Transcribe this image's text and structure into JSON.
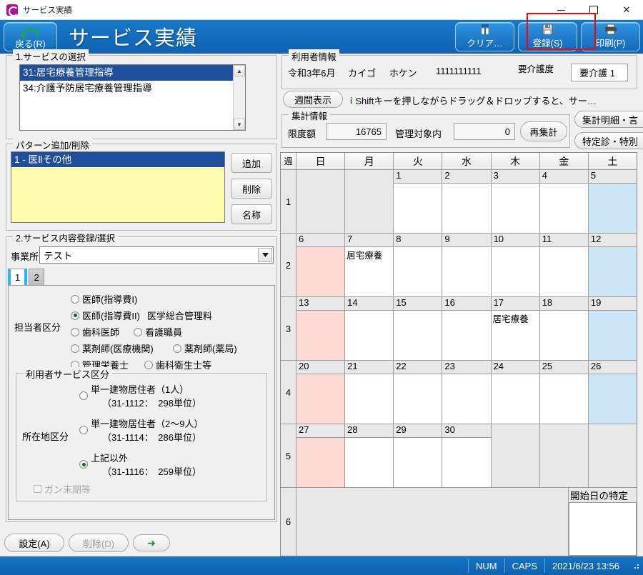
{
  "window": {
    "title": "サービス実績",
    "icon": "app-icon",
    "minimize": "–",
    "maximize": "▫",
    "close": "✕"
  },
  "header": {
    "back_label": "戻る(R)",
    "back_key": "R",
    "page_title": "サービス実績",
    "buttons": [
      {
        "name": "clear",
        "label": "クリア…",
        "icon": "eraser-icon"
      },
      {
        "name": "register",
        "label": "登録(S)",
        "icon": "floppy-disk-icon",
        "highlighted": true
      },
      {
        "name": "print",
        "label": "印刷(P)",
        "icon": "printer-icon"
      }
    ],
    "highlight_color": "#ff0000"
  },
  "service_select": {
    "legend": "1.サービスの選択",
    "items": [
      {
        "label": "31:居宅療養管理指導",
        "selected": true
      },
      {
        "label": "34:介護予防居宅療養管理指導",
        "selected": false
      }
    ]
  },
  "pattern": {
    "legend": "パターン追加/削除",
    "items": [
      {
        "label": "1 - 医Ⅱその他",
        "selected": true
      }
    ],
    "buttons": [
      {
        "name": "add",
        "label": "追加"
      },
      {
        "name": "delete",
        "label": "削除"
      },
      {
        "name": "rename",
        "label": "名称"
      }
    ]
  },
  "service_content": {
    "legend": "2.サービス内容登録/選択",
    "office_label": "事業所",
    "office_value": "テスト",
    "tabs": [
      {
        "label": "1",
        "active": true
      },
      {
        "label": "2",
        "active": false
      }
    ],
    "staff_label": "担当者区分",
    "staff_options": [
      {
        "label": "医師(指導費I)",
        "selected": false
      },
      {
        "label": "医師(指導費II)",
        "selected": true,
        "extra": "医学総合管理料"
      },
      {
        "label": "歯科医師",
        "selected": false
      },
      {
        "label": "看護職員",
        "selected": false
      },
      {
        "label": "薬剤師(医療機関)",
        "selected": false
      },
      {
        "label": "薬剤師(薬局)",
        "selected": false
      },
      {
        "label": "管理栄養士",
        "selected": false
      },
      {
        "label": "歯科衛生士等",
        "selected": false
      }
    ],
    "user_service_legend": "利用者サービス区分",
    "location_label": "所在地区分",
    "location_options": [
      {
        "line1": "単一建物居住者（1人）",
        "line2": "（31-1112：　298単位）",
        "selected": false
      },
      {
        "line1": "単一建物居住者（2〜9人）",
        "line2": "（31-1114：　286単位）",
        "selected": false
      },
      {
        "line1": "上記以外",
        "line2": "（31-1116：　259単位）",
        "selected": true
      }
    ],
    "cancer_checkbox": {
      "label": "ガン末期等",
      "checked": false,
      "disabled": true
    }
  },
  "user_info": {
    "legend": "利用者情報",
    "period": "令和3年6月",
    "name_kana1": "カイゴ",
    "name_kana2": "ホケン",
    "insured_no": "1111111111",
    "care_level_label": "要介護度",
    "care_level_value": "要介護 1"
  },
  "toolbar2": {
    "weekly_view": "週間表示",
    "info_icon": "info-icon",
    "hint": "Shiftキーを押しながらドラッグ＆ドロップすると、サー…"
  },
  "aggregate": {
    "legend": "集計情報",
    "limit_label": "限度額",
    "limit_value": "16765",
    "managed_label": "管理対象内",
    "managed_value": "0",
    "recalc_label": "再集計",
    "side_buttons": [
      {
        "name": "detail",
        "label": "集計明細・言"
      },
      {
        "name": "special",
        "label": "特定診・特別"
      }
    ]
  },
  "calendar": {
    "week_header": "週",
    "weekday_headers": [
      "日",
      "月",
      "火",
      "水",
      "木",
      "金",
      "土"
    ],
    "rows": [
      {
        "week": "1",
        "days": [
          {
            "num": "",
            "empty": true
          },
          {
            "num": "",
            "empty": true
          },
          {
            "num": "1",
            "entry": ""
          },
          {
            "num": "2",
            "entry": ""
          },
          {
            "num": "3",
            "entry": ""
          },
          {
            "num": "4",
            "entry": ""
          },
          {
            "num": "5",
            "entry": "",
            "sat": true
          }
        ]
      },
      {
        "week": "2",
        "days": [
          {
            "num": "6",
            "entry": "",
            "sun": true
          },
          {
            "num": "7",
            "entry": "居宅療養"
          },
          {
            "num": "8",
            "entry": ""
          },
          {
            "num": "9",
            "entry": ""
          },
          {
            "num": "10",
            "entry": ""
          },
          {
            "num": "11",
            "entry": ""
          },
          {
            "num": "12",
            "entry": "",
            "sat": true
          }
        ]
      },
      {
        "week": "3",
        "days": [
          {
            "num": "13",
            "entry": "",
            "sun": true
          },
          {
            "num": "14",
            "entry": ""
          },
          {
            "num": "15",
            "entry": ""
          },
          {
            "num": "16",
            "entry": ""
          },
          {
            "num": "17",
            "entry": "居宅療養"
          },
          {
            "num": "18",
            "entry": ""
          },
          {
            "num": "19",
            "entry": "",
            "sat": true
          }
        ]
      },
      {
        "week": "4",
        "days": [
          {
            "num": "20",
            "entry": "",
            "sun": true
          },
          {
            "num": "21",
            "entry": ""
          },
          {
            "num": "22",
            "entry": ""
          },
          {
            "num": "23",
            "entry": ""
          },
          {
            "num": "24",
            "entry": ""
          },
          {
            "num": "25",
            "entry": ""
          },
          {
            "num": "26",
            "entry": "",
            "sat": true
          }
        ]
      },
      {
        "week": "5",
        "days": [
          {
            "num": "27",
            "entry": "",
            "sun": true
          },
          {
            "num": "28",
            "entry": ""
          },
          {
            "num": "29",
            "entry": ""
          },
          {
            "num": "30",
            "entry": ""
          },
          {
            "num": "",
            "empty": true
          },
          {
            "num": "",
            "empty": true
          },
          {
            "num": "",
            "empty": true
          }
        ]
      }
    ],
    "last_row_week": "6",
    "undated_label": "開始日の特定できないサービス",
    "undated_value": ""
  },
  "bottom_buttons": [
    {
      "name": "settings",
      "label": "設定(A)",
      "disabled": false
    },
    {
      "name": "delete",
      "label": "削除(D)",
      "disabled": true
    },
    {
      "name": "next",
      "label": "➜",
      "disabled": false
    }
  ],
  "statusbar": {
    "num": "NUM",
    "caps": "CAPS",
    "datetime": "2021/6/23 13:56"
  }
}
